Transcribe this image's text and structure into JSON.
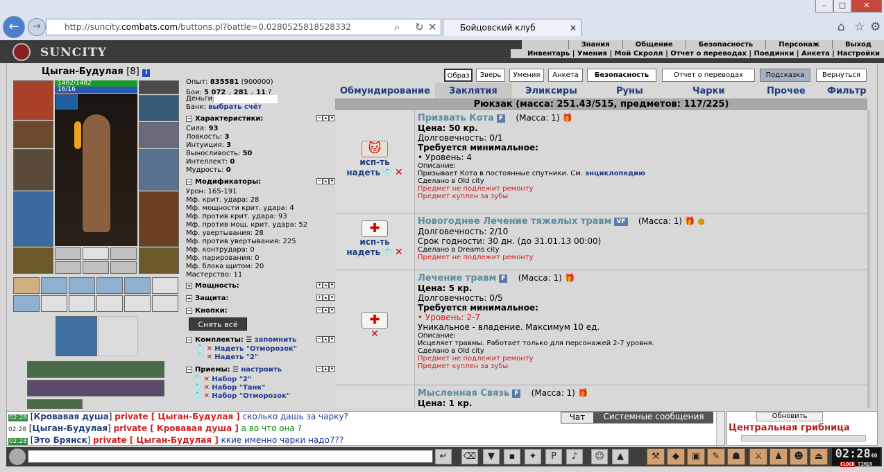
{
  "browser": {
    "url_pre": "http://suncity.",
    "url_domain": "combats.com",
    "url_post": "/buttons.pl?battle=0.0280525818528332",
    "tab_title": "Бойцовский клуб",
    "back": "←",
    "fwd": "→",
    "search": "⌕",
    "refresh": "↻",
    "stop": "✕",
    "home": "⌂",
    "star": "☆",
    "gear": "⚙",
    "tab_close": "×",
    "min": "–",
    "max": "□",
    "close": "✕"
  },
  "header": {
    "logo": "SUNCITY",
    "top_menu": [
      "Знания",
      "Общение",
      "Безопасность",
      "Персонаж",
      "Выход"
    ],
    "sub_menu": "Инвентарь | Умения | Мой Скролл | Отчет о переводах | Поединки | Анкета | Настройки"
  },
  "character": {
    "name": "Цыган-Будулая",
    "level": "[8]",
    "info": "i",
    "hp": "1482/1482",
    "mana": "16/16"
  },
  "stats": {
    "exp_label": "Опыт:",
    "exp": "835581",
    "exp_next": "(900000)",
    "battles_label": "Бои:",
    "wins": "5 072",
    "losses": "281",
    "draws": "11",
    "q": "?",
    "money_label": "Деньги:",
    "bank_label": "Банк:",
    "bank_link": "выбрать счёт"
  },
  "sections": {
    "characteristics": "Характеристики:",
    "modifiers": "Модификаторы:",
    "power": "Мощность:",
    "protection": "Защита:",
    "buttons": "Кнопки:",
    "sets": "Комплекты:",
    "remember": "запомнить",
    "techniques": "Приемы:",
    "setup": "настроить",
    "take_off": "Снять всё"
  },
  "chars": [
    {
      "l": "Сила:",
      "v": "93"
    },
    {
      "l": "Ловкость:",
      "v": "3"
    },
    {
      "l": "Интуиция:",
      "v": "3"
    },
    {
      "l": "Выносливость:",
      "v": "50"
    },
    {
      "l": "Интеллект:",
      "v": "0"
    },
    {
      "l": "Мудрость:",
      "v": "0"
    }
  ],
  "mods": [
    "Урон: 165-191",
    "Мф. крит. удара: 28",
    "Мф. мощности крит. удара: 4",
    "Мф. против крит. удара: 93",
    "Мф. против мощ. крит. удара: 52",
    "Мф. увертывания: 28",
    "Мф. против увертывания: 225",
    "Мф. контрудара: 0",
    "Мф. парирования: 0",
    "Мф. блока щитом: 20",
    "Мастерство: 11"
  ],
  "sets": [
    "Надеть \"Отморозок\"",
    "Надеть \"2\""
  ],
  "techs": [
    "Набор \"2\"",
    "Набор \"Танк\"",
    "Набор \"Отморозок\""
  ],
  "top_buttons": [
    "Образ",
    "Зверь",
    "Умения",
    "Анкета",
    "Безопасность",
    "Отчет о переводах",
    "Подсказка",
    "Вернуться"
  ],
  "inv_tabs": [
    "Обмундирование",
    "Заклятия",
    "Эликсиры",
    "Руны",
    "Чарки",
    "Прочее",
    "Фильтр"
  ],
  "backpack": "Рюкзак (масса: 251.43/515, предметов: 117/225)",
  "use_label": "исп-ть",
  "wear_label": "надеть",
  "items": [
    {
      "name": "Призвать Кота",
      "badge": "F",
      "mass": "(Масса: 1)",
      "l1": "Цена: 50 кр.",
      "l2": "Долговечность: 0/1",
      "l3": "Требуется минимальное:",
      "l4": "• Уровень: 4",
      "d0": "Описание:",
      "d1": "Призывает Кота в постоянные спутники. См.",
      "d1link": "энциклопедию",
      "d2": "Сделано в Old city",
      "r1": "Предмет не подлежит ремонту",
      "r2": "Предмет куплен за зубы"
    },
    {
      "name": "Новогоднее Лечение тяжелых травм",
      "badge": "VF",
      "mass": "(Масса: 1)",
      "l1": "Долговечность: 2/10",
      "l2": "Срок годности: 30 дн. (до 31.01.13 00:00)",
      "d2": "Сделано в Dreams city",
      "r1": "Предмет не подлежит ремонту"
    },
    {
      "name": "Лечение травм",
      "badge": "F",
      "mass": "(Масса: 1)",
      "l1": "Цена: 5 кр.",
      "l2": "Долговечность: 0/5",
      "l3": "Требуется минимальное:",
      "l4": "• Уровень: 2-7",
      "l5": "Уникальное - владение. Максимум 10 ед.",
      "d0": "Описание:",
      "d1": "Исцеляет травмы. Работает только для персонажей 2-7 уровня.",
      "d2": "Сделано в Old city",
      "r1": "Предмет не подлежит ремонту",
      "r2": "Предмет куплен за зубы"
    },
    {
      "name": "Мысленная Связь",
      "badge": "F",
      "mass": "(Масса: 1)",
      "l1": "Цена: 1 кр."
    }
  ],
  "chat": [
    {
      "time": "02:28",
      "nick": "Кровавая душа",
      "priv": "private [ Цыган-Будулая ]",
      "msg": "сколько дашь за чарку?"
    },
    {
      "time": "02:28",
      "nick": "Цыган-Будулая",
      "priv": "private [ Кровавая душа ]",
      "msg": "а во что она ?"
    },
    {
      "time": "02:28",
      "nick": "Это Брянск",
      "priv": "private [ Цыган-Будулая ]",
      "msg": "ккие именно чарки надо7??"
    }
  ],
  "chat_tabs": {
    "chat": "Чат",
    "system": "Системные сообщения"
  },
  "location": {
    "refresh": "Обновить",
    "name": "Центральная грибница"
  },
  "clock": {
    "time": "02:28",
    "sec": "40",
    "brand1": "CLOCK",
    "brand2": "TIMER"
  }
}
